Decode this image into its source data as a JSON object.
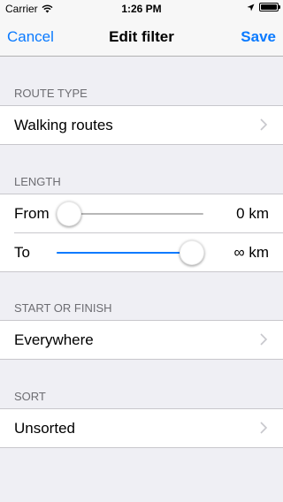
{
  "status_bar": {
    "carrier": "Carrier",
    "time": "1:26 PM"
  },
  "nav": {
    "cancel": "Cancel",
    "title": "Edit filter",
    "save": "Save"
  },
  "route_type": {
    "header": "ROUTE TYPE",
    "value": "Walking routes"
  },
  "length": {
    "header": "LENGTH",
    "from": {
      "label": "From",
      "value": "0 km",
      "slider_fraction": 0.0
    },
    "to": {
      "label": "To",
      "value": "∞ km",
      "slider_fraction": 1.0
    }
  },
  "start_or_finish": {
    "header": "START OR FINISH",
    "value": "Everywhere"
  },
  "sort": {
    "header": "SORT",
    "value": "Unsorted"
  },
  "colors": {
    "accent": "#0a7aff",
    "background": "#efeff4"
  },
  "icons": [
    "wifi-icon",
    "location-arrow-icon",
    "battery-icon",
    "chevron-right-icon"
  ]
}
